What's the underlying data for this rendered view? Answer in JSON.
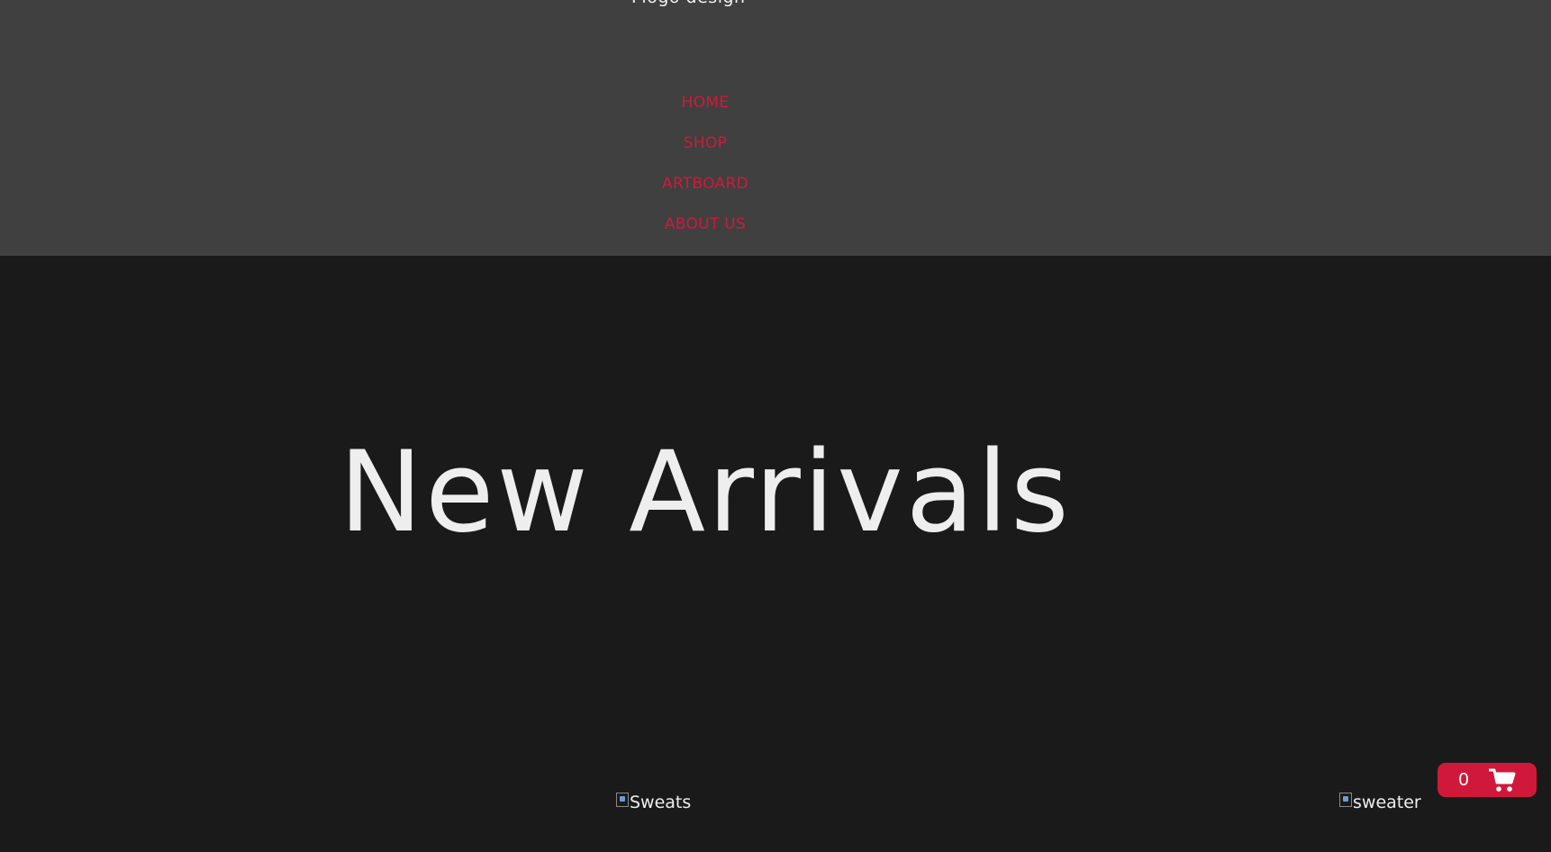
{
  "header": {
    "logo_text": "Flogo design",
    "nav": [
      {
        "label": "HOME"
      },
      {
        "label": "SHOP"
      },
      {
        "label": "ARTBOARD"
      },
      {
        "label": "ABOUT US"
      }
    ]
  },
  "hero": {
    "title": "New Arrivals"
  },
  "products": [
    {
      "alt_text": "Sweats"
    },
    {
      "alt_text": "sweater"
    }
  ],
  "cart": {
    "count": "0",
    "icon": "shopping-cart-icon"
  },
  "colors": {
    "header_bg": "#404040",
    "page_bg": "#1a1a1a",
    "accent": "#d0193a",
    "text": "#eeeeee"
  }
}
